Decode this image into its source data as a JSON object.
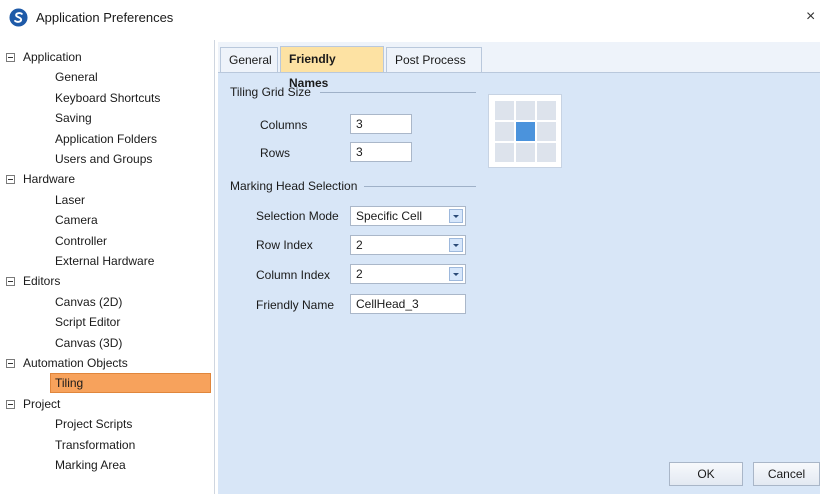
{
  "window": {
    "title": "Application Preferences",
    "close_glyph": "×",
    "app_icon": "app-logo-icon"
  },
  "tree": [
    {
      "label": "Application",
      "children": [
        "General",
        "Keyboard Shortcuts",
        "Saving",
        "Application Folders",
        "Users and Groups"
      ]
    },
    {
      "label": "Hardware",
      "children": [
        "Laser",
        "Camera",
        "Controller",
        "External Hardware"
      ]
    },
    {
      "label": "Editors",
      "children": [
        "Canvas (2D)",
        "Script Editor",
        "Canvas (3D)"
      ]
    },
    {
      "label": "Automation Objects",
      "children": [
        "Tiling"
      ]
    },
    {
      "label": "Project",
      "children": [
        "Project Scripts",
        "Transformation",
        "Marking Area"
      ]
    }
  ],
  "selected_item": "Tiling",
  "tabs": [
    "General",
    "Friendly Names",
    "Post Process"
  ],
  "active_tab": "Friendly Names",
  "tiling_grid": {
    "heading": "Tiling Grid Size",
    "columns_label": "Columns",
    "columns_value": "3",
    "rows_label": "Rows",
    "rows_value": "3"
  },
  "marking_head": {
    "heading": "Marking Head Selection",
    "selection_mode_label": "Selection Mode",
    "selection_mode_value": "Specific Cell",
    "row_index_label": "Row Index",
    "row_index_value": "2",
    "column_index_label": "Column Index",
    "column_index_value": "2",
    "friendly_name_label": "Friendly Name",
    "friendly_name_value": "CellHead_3"
  },
  "grid_preview": {
    "rows": 3,
    "columns": 3,
    "highlight_row": 2,
    "highlight_column": 2
  },
  "buttons": {
    "ok": "OK",
    "cancel": "Cancel"
  },
  "colors": {
    "selection": "#f7a25c",
    "active_tab": "#fde2a3",
    "panel": "#d8e6f7",
    "cell_active": "#4b93dc"
  }
}
